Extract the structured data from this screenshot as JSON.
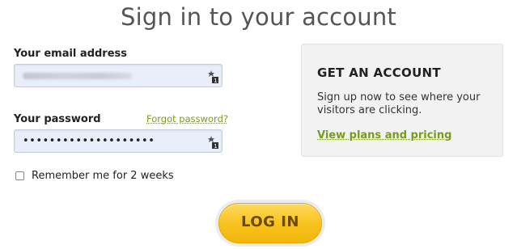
{
  "page": {
    "title": "Sign in to your account"
  },
  "login_form": {
    "email": {
      "label": "Your email address",
      "value": ""
    },
    "password": {
      "label": "Your password",
      "forgot_label": "Forgot password?",
      "masked_value": "••••••••••••••••••••"
    },
    "remember": {
      "label": "Remember me for 2 weeks",
      "checked": false
    },
    "login_button_label": "LOG IN"
  },
  "account_panel": {
    "heading": "GET AN ACCOUNT",
    "description": "Sign up now to see where your visitors are clicking.",
    "plans_link_label": "View plans and pricing"
  },
  "colors": {
    "link_green": "#7a9a1d",
    "button_yellow": "#f8c21c",
    "input_bg": "#e8eefa"
  },
  "icons": {
    "field_key_icon": "keychain-icon"
  }
}
